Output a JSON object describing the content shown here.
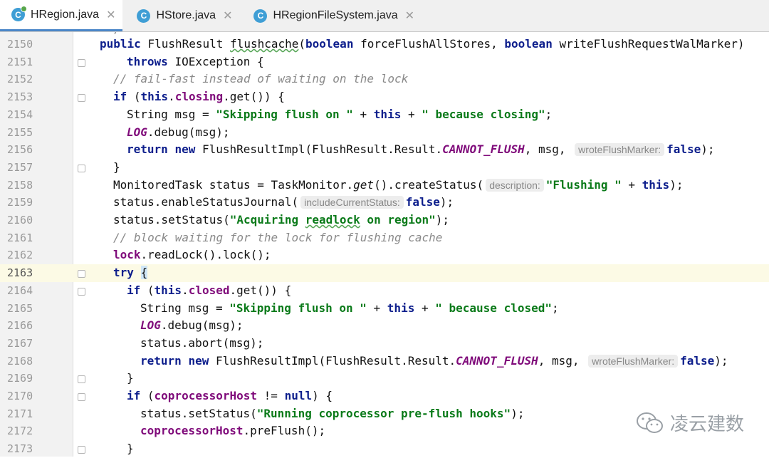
{
  "tabs": [
    {
      "label": "HRegion.java",
      "icon": "c"
    },
    {
      "label": "HStore.java",
      "icon": "c"
    },
    {
      "label": "HRegionFileSystem.java",
      "icon": "c"
    }
  ],
  "prev_line_fragment": "*/",
  "lines": [
    {
      "num": "2150"
    },
    {
      "num": "2151"
    },
    {
      "num": "2152"
    },
    {
      "num": "2153"
    },
    {
      "num": "2154"
    },
    {
      "num": "2155"
    },
    {
      "num": "2156"
    },
    {
      "num": "2157"
    },
    {
      "num": "2158"
    },
    {
      "num": "2159"
    },
    {
      "num": "2160"
    },
    {
      "num": "2161"
    },
    {
      "num": "2162"
    },
    {
      "num": "2163"
    },
    {
      "num": "2164"
    },
    {
      "num": "2165"
    },
    {
      "num": "2166"
    },
    {
      "num": "2167"
    },
    {
      "num": "2168"
    },
    {
      "num": "2169"
    },
    {
      "num": "2170"
    },
    {
      "num": "2171"
    },
    {
      "num": "2172"
    },
    {
      "num": "2173"
    }
  ],
  "t": {
    "public": "public",
    "FlushResult": "FlushResult",
    "flushcache": "flushcache",
    "boolean": "boolean",
    "forceFlushAllStores": "forceFlushAllStores,",
    "writeFlushRequestWalMarker": "writeFlushRequestWalMarker)",
    "throws": "throws",
    "IOException": "IOException {",
    "cmt1": "// fail-fast instead of waiting on the lock",
    "if": "if",
    "this": "this",
    "closing": "closing",
    "get": ".get()) {",
    "String": "String msg = ",
    "str_skip": "\"Skipping flush on \"",
    "plus": " + ",
    "str_closing": "\" because closing\"",
    "semi": ";",
    "LOG": "LOG",
    "debug": ".debug(msg);",
    "return": "return",
    "new": "new",
    "impl": "FlushResultImpl(FlushResult.Result.",
    "CANNOT_FLUSH": "CANNOT_FLUSH",
    "msg_comma": ", msg, ",
    "hint_wrote": "wroteFlushMarker:",
    "false": "false",
    "close_paren": ");",
    "rbrace": "}",
    "mt": "MonitoredTask status = TaskMonitor.",
    "get_it": "get",
    "createStatus": "().createStatus(",
    "hint_desc": "description:",
    "str_flushing": "\"Flushing \"",
    "close_paren2": ");",
    "enableJournal": "status.enableStatusJournal(",
    "hint_include": "includeCurrentStatus:",
    "setStatus": "status.setStatus(",
    "str_acq1": "\"Acquiring ",
    "str_readlock": "readlock",
    "str_acq2": " on region\"",
    "cmt2": "// block waiting for the lock for flushing cache",
    "lock": "lock",
    "readLock": ".readLock().lock();",
    "try": "try",
    "lbrace": "{",
    "if2_open": " (",
    "closed": "closed",
    "str_closed": "\" because closed\"",
    "abort": "status.abort(msg);",
    "copHost": "coprocessorHost",
    "neq": " != ",
    "null": "null",
    "brace_tail": ") {",
    "str_running": "\"Running coprocessor pre-flush hooks\"",
    "preFlush": ".preFlush();"
  },
  "watermark": "凌云建数"
}
